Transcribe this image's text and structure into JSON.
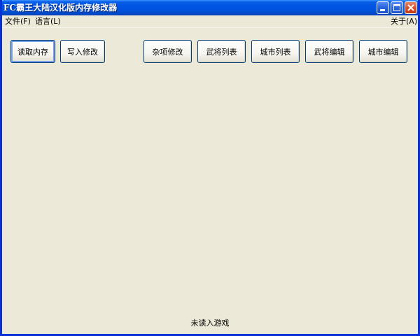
{
  "window": {
    "title": "FC霸王大陆汉化版内存修改器"
  },
  "menu": {
    "file": "文件(F)",
    "language": "语言(L)",
    "about": "关于(A)"
  },
  "buttons": {
    "read_memory": "读取内存",
    "write_changes": "写入修改",
    "misc_edit": "杂项修改",
    "general_list": "武将列表",
    "city_list": "城市列表",
    "general_edit": "武将编辑",
    "city_edit": "城市编辑"
  },
  "status": {
    "text": "未读入游戏"
  },
  "icons": [
    "minimize-icon",
    "maximize-icon",
    "close-icon"
  ]
}
